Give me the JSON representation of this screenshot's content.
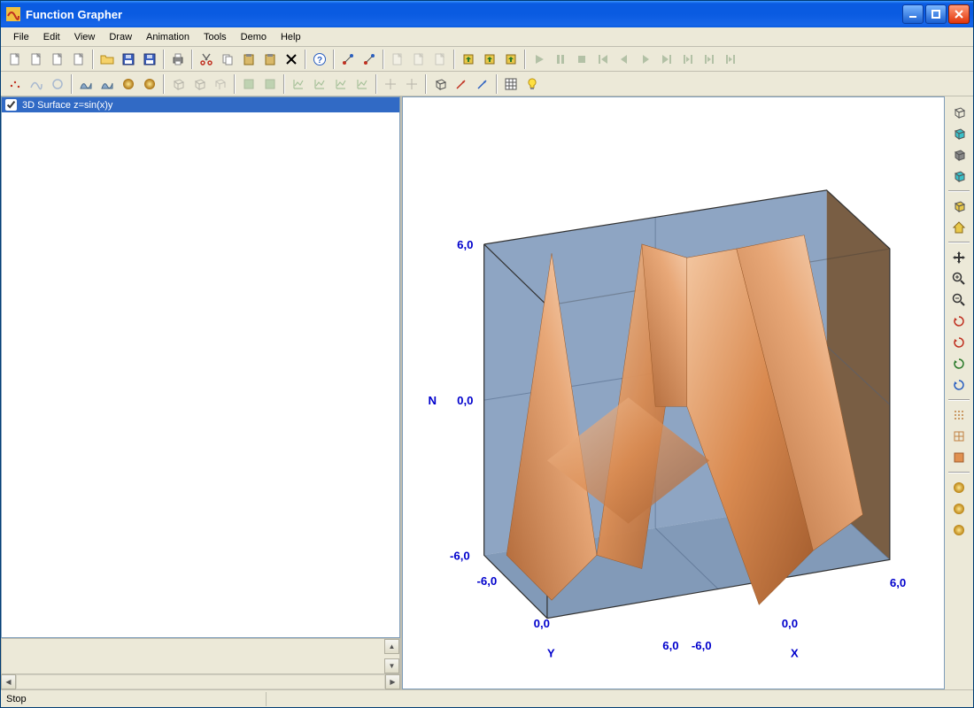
{
  "app": {
    "title": "Function Grapher"
  },
  "menu": [
    "File",
    "Edit",
    "View",
    "Draw",
    "Animation",
    "Tools",
    "Demo",
    "Help"
  ],
  "toolbar1": [
    {
      "name": "new-icon",
      "d": false
    },
    {
      "name": "new2-icon",
      "d": false
    },
    {
      "name": "open-template-icon",
      "d": false
    },
    {
      "name": "template-icon",
      "d": false
    },
    {
      "sep": 1
    },
    {
      "name": "open-folder-icon",
      "d": false
    },
    {
      "name": "save-icon",
      "d": false
    },
    {
      "name": "save-as-icon",
      "d": false
    },
    {
      "sep": 1
    },
    {
      "name": "print-icon",
      "d": false
    },
    {
      "sep": 1
    },
    {
      "name": "cut-icon",
      "d": false
    },
    {
      "name": "copy-icon",
      "d": false
    },
    {
      "name": "paste-icon",
      "d": false
    },
    {
      "name": "paste-special-icon",
      "d": false
    },
    {
      "name": "delete-icon",
      "d": false
    },
    {
      "sep": 1
    },
    {
      "name": "help-icon",
      "d": false
    },
    {
      "sep": 1
    },
    {
      "name": "trace-icon",
      "d": false
    },
    {
      "name": "trace2-icon",
      "d": false
    },
    {
      "sep": 1
    },
    {
      "name": "plot-a-icon",
      "d": true
    },
    {
      "name": "plot-b-icon",
      "d": true
    },
    {
      "name": "plot-c-icon",
      "d": true
    },
    {
      "sep": 1
    },
    {
      "name": "export-a-icon",
      "d": false
    },
    {
      "name": "export-b-icon",
      "d": false
    },
    {
      "name": "export-c-icon",
      "d": false
    },
    {
      "sep": 1
    },
    {
      "name": "play-icon",
      "d": true
    },
    {
      "name": "pause-icon",
      "d": true
    },
    {
      "name": "stop-icon",
      "d": true
    },
    {
      "name": "first-icon",
      "d": true
    },
    {
      "name": "prev-icon",
      "d": true
    },
    {
      "name": "next-icon",
      "d": true
    },
    {
      "name": "last-icon",
      "d": true
    },
    {
      "name": "loop-a-icon",
      "d": true
    },
    {
      "name": "loop-b-icon",
      "d": true
    },
    {
      "name": "loop-c-icon",
      "d": true
    }
  ],
  "toolbar2": [
    {
      "name": "scatter-icon",
      "d": false
    },
    {
      "name": "curve-icon",
      "d": true
    },
    {
      "name": "circle-icon",
      "d": true
    },
    {
      "sep": 1
    },
    {
      "name": "area-icon",
      "d": false
    },
    {
      "name": "shaded-icon",
      "d": false
    },
    {
      "name": "sphere-a-icon",
      "d": false
    },
    {
      "name": "sphere-b-icon",
      "d": false
    },
    {
      "sep": 1
    },
    {
      "name": "box-a-icon",
      "d": true
    },
    {
      "name": "box-b-icon",
      "d": true
    },
    {
      "name": "grid3d-icon",
      "d": true
    },
    {
      "sep": 1
    },
    {
      "name": "green-a-icon",
      "d": true
    },
    {
      "name": "green-b-icon",
      "d": true
    },
    {
      "sep": 1
    },
    {
      "name": "chart-a-icon",
      "d": true
    },
    {
      "name": "chart-b-icon",
      "d": true
    },
    {
      "name": "chart-c-icon",
      "d": true
    },
    {
      "name": "chart-d-icon",
      "d": true
    },
    {
      "sep": 1
    },
    {
      "name": "axis-a-icon",
      "d": true
    },
    {
      "name": "axis-b-icon",
      "d": true
    },
    {
      "sep": 1
    },
    {
      "name": "cube-tool-icon",
      "d": false
    },
    {
      "name": "vector-red-icon",
      "d": false
    },
    {
      "name": "vector-blue-icon",
      "d": false
    },
    {
      "sep": 1
    },
    {
      "name": "table-icon",
      "d": false
    },
    {
      "name": "bulb-icon",
      "d": false
    }
  ],
  "functionList": {
    "items": [
      {
        "checked": true,
        "label": "3D Surface  z=sin(x)y"
      }
    ]
  },
  "rightTools": [
    {
      "name": "cube-wire-icon",
      "d": false
    },
    {
      "name": "cube-wire-cyan-icon",
      "d": false
    },
    {
      "name": "cube-solid-icon",
      "d": false
    },
    {
      "name": "cube-cyan-icon",
      "d": false
    },
    {
      "sep": 1
    },
    {
      "name": "cube-yellow-icon",
      "d": false
    },
    {
      "name": "house-icon",
      "d": false
    },
    {
      "sep": 1
    },
    {
      "name": "move-icon",
      "d": false
    },
    {
      "name": "zoom-in-icon",
      "d": false
    },
    {
      "name": "zoom-out-icon",
      "d": false
    },
    {
      "name": "rotate-icon",
      "d": false
    },
    {
      "name": "rotate-x-icon",
      "d": false
    },
    {
      "name": "rotate-y-icon",
      "d": false
    },
    {
      "name": "rotate-z-icon",
      "d": false
    },
    {
      "sep": 1
    },
    {
      "name": "mesh-points-icon",
      "d": false
    },
    {
      "name": "mesh-wire-icon",
      "d": false
    },
    {
      "name": "mesh-fill-icon",
      "d": false
    },
    {
      "sep": 1
    },
    {
      "name": "ball-a-icon",
      "d": false
    },
    {
      "name": "ball-b-icon",
      "d": false
    },
    {
      "name": "ball-c-icon",
      "d": false
    }
  ],
  "status": {
    "text": "Stop"
  },
  "chart_data": {
    "type": "surface3d",
    "formula": "z = sin(x) * y",
    "xlabel": "X",
    "ylabel": "Y",
    "zlabel": "N",
    "xlim": [
      -6.0,
      6.0
    ],
    "ylim": [
      -6.0,
      6.0
    ],
    "zlim": [
      -6.0,
      6.0
    ],
    "xticks": [
      -6.0,
      0.0,
      6.0
    ],
    "yticks": [
      -6.0,
      0.0,
      6.0
    ],
    "zticks": [
      -6.0,
      0.0,
      6.0
    ],
    "surface_color": "#d99057",
    "box_color": "#7a95b8"
  }
}
